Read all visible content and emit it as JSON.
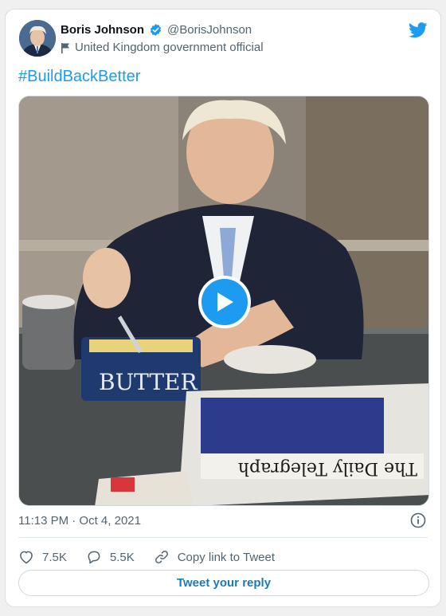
{
  "author": {
    "display_name": "Boris Johnson",
    "handle": "@BorisJohnson",
    "affiliation": "United Kingdom government official",
    "verified": true
  },
  "tweet": {
    "text": "#BuildBackBetter",
    "timestamp": "11:13 PM · Oct 4, 2021",
    "media": {
      "type": "video",
      "butter_dish_label": "BUTTER",
      "newspaper_masthead": "The Daily Telegraph"
    }
  },
  "actions": {
    "likes": "7.5K",
    "replies": "5.5K",
    "copy_link_label": "Copy link to Tweet"
  },
  "reply_button_label": "Tweet your reply",
  "colors": {
    "accent": "#1d9bf0",
    "text_secondary": "#536471",
    "border": "#cfd9de"
  },
  "icons": [
    "verified-badge-icon",
    "flag-icon",
    "twitter-logo-icon",
    "play-icon",
    "info-icon",
    "heart-icon",
    "reply-bubble-icon",
    "link-icon"
  ]
}
